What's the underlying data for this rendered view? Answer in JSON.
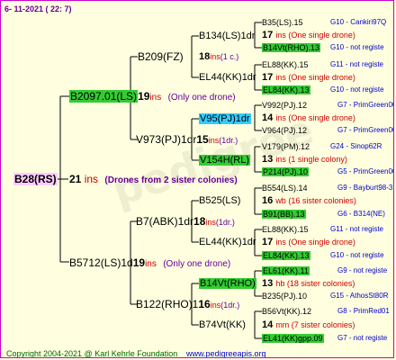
{
  "header": {
    "date": "6- 11-2021 ( 22: 7)"
  },
  "root": {
    "label": "B28(RS)",
    "count": "21",
    "ins": "ins",
    "note": "(Drones from 2 sister colonies)"
  },
  "g1a": {
    "label": "B2097.01(LS)",
    "count": "19",
    "ins": "ins",
    "note": "(Only one drone)"
  },
  "g1b": {
    "label": "B5712(LS)1d",
    "count": "19",
    "ins": "ins",
    "note": "(Only one drone)"
  },
  "g2": [
    {
      "label": "B209(FZ)"
    },
    {
      "label": "V973(PJ)1dr",
      "count": "15",
      "ins": "ins",
      "note": "(1dr.)"
    },
    {
      "label": "B7(ABK)1dr",
      "count": "18",
      "ins": "ins",
      "note": "(1dr.)"
    },
    {
      "label": "B122(RHO)1",
      "count": "16",
      "ins": "ins",
      "note": "(1dr.)"
    }
  ],
  "g3": [
    {
      "label": "B134(LS)1dr",
      "count": "18",
      "ins": "ins",
      "note": "(1 c.)"
    },
    {
      "label": "EL44(KK)1dr"
    },
    {
      "label": "V95(PJ)1dr"
    },
    {
      "label": "V154H(RL)"
    },
    {
      "label": "B525(LS)"
    },
    {
      "label": "EL44(KK)1dr"
    },
    {
      "label": "B14Vt(RHO)"
    },
    {
      "label": "B74Vt(KK)"
    }
  ],
  "i": [
    {
      "n": "17",
      "ins": "ins (One single drone)",
      "note": ""
    },
    {
      "n": "17",
      "ins": "ins (One single drone)",
      "note": ""
    },
    {
      "n": "14",
      "ins": "ins (One single drone)",
      "note": ""
    },
    {
      "n": "13",
      "ins": "ins (1 single colony)",
      "note": ""
    },
    {
      "n": "16",
      "ins": "wb (16 sister colonies)",
      "note": ""
    },
    {
      "n": "17",
      "ins": "ins (One single drone)",
      "note": ""
    },
    {
      "n": "13",
      "ins": "hb (18 sister colonies)",
      "note": ""
    },
    {
      "n": "14",
      "ins": "mm (7 sister colonies)",
      "note": ""
    }
  ],
  "leaves": [
    {
      "label": "B35(LS).15",
      "note": "G10 - Cankiri97Q",
      "hl": false
    },
    {
      "label": "B14Vt(RHO).13",
      "note": "G10 - not registe",
      "hl": true
    },
    {
      "label": "EL88(KK).15",
      "note": "G11 - not registe",
      "hl": false
    },
    {
      "label": "EL84(KK).13",
      "note": "G10 - not registe",
      "hl": true
    },
    {
      "label": "V992(PJ).12",
      "note": "G7 - PrimGreen00",
      "hl": false
    },
    {
      "label": "V964(PJ).12",
      "note": "G7 - PrimGreen00",
      "hl": false
    },
    {
      "label": "V179(PM).12",
      "note": "G24 - Sinop62R",
      "hl": false
    },
    {
      "label": "P214(PJ).10",
      "note": "G5 - PrimGreen00",
      "hl": true
    },
    {
      "label": "B554(LS).14",
      "note": "G9 - Bayburt98-3",
      "hl": false
    },
    {
      "label": "B91(BB).13",
      "note": "G6 - B314(NE)",
      "hl": true
    },
    {
      "label": "EL88(KK).15",
      "note": "G11 - not registe",
      "hl": false
    },
    {
      "label": "EL84(KK).13",
      "note": "G10 - not registe",
      "hl": true
    },
    {
      "label": "EL61(KK).11",
      "note": "G9 - not registe",
      "hl": true
    },
    {
      "label": "B235(PJ).10",
      "note": "G15 - AthosSt80R",
      "hl": false
    },
    {
      "label": "B56Vt(KK).12",
      "note": "G8 - PrimRed01",
      "hl": false
    },
    {
      "label": "EL41(KK)gpp.09",
      "note": "G7 - not registe",
      "hl": true
    }
  ],
  "footer": {
    "copyright": "Copyright 2004-2021 @ Karl Kehrle Foundation",
    "url": "www.pedigreeapis.org"
  }
}
